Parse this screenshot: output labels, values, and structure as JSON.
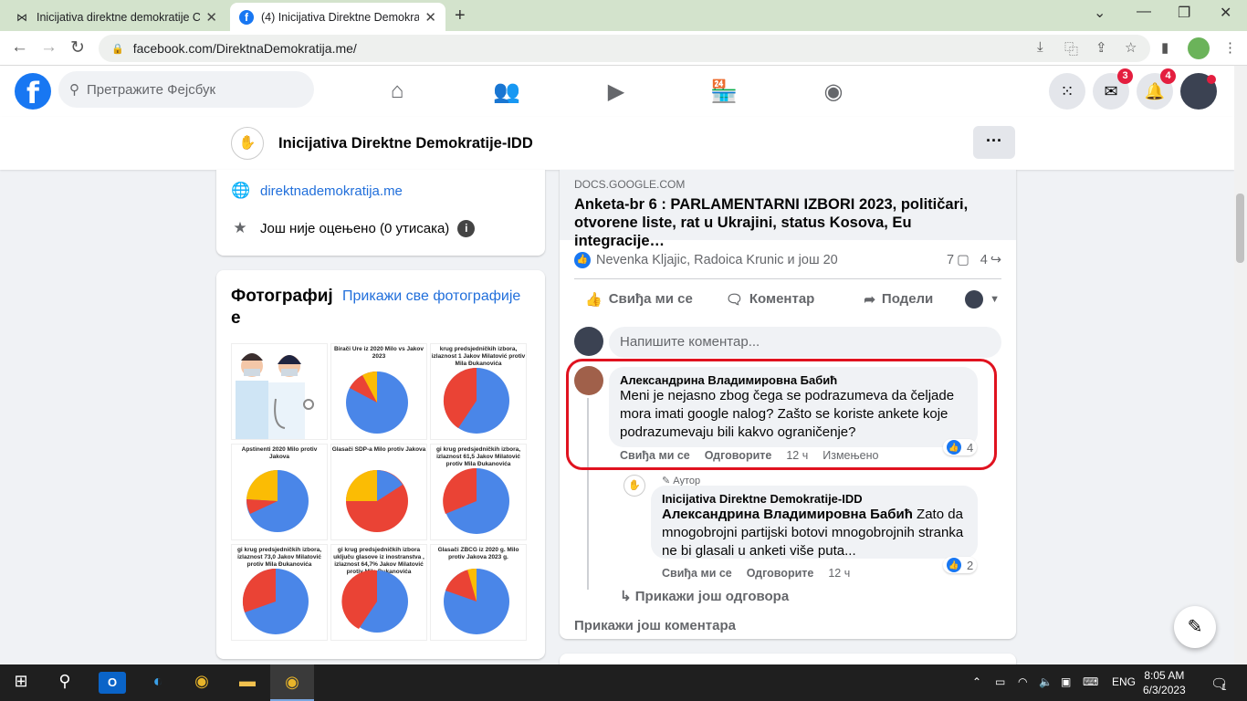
{
  "browser": {
    "tabs": [
      {
        "title": "Inicijativa direktne demokratije C",
        "active": false
      },
      {
        "title": "(4) Inicijativa Direktne Demokratij",
        "active": true
      }
    ],
    "new_tab": "+",
    "url": "facebook.com/DirektnaDemokratija.me/",
    "controls": {
      "minimize": "⌄",
      "restore": "—",
      "maximize": "❐",
      "close": "✕"
    }
  },
  "fb": {
    "logo": "f",
    "search_placeholder": "Претражите Фејсбук",
    "messenger_badge": "3",
    "notif_badge": "4"
  },
  "page": {
    "name": "Inicijativa Direktne Demokratije-IDD",
    "more": "···",
    "website": "direktnademokratija.me",
    "rating": "Још није оцењено (0 утисака)",
    "photos_title": "Фотографије",
    "photos_title_a": "Фотографиј",
    "photos_title_b": "е",
    "photos_all": "Прикажи све фотографије",
    "photos": [
      {
        "caption": ""
      },
      {
        "caption": "Birači Ure iz 2020 Milo vs Jakov 2023"
      },
      {
        "caption": "krug predsjedničkih izbora, izlaznost 1 Jakov Milatović protiv Mila Đukanovića"
      },
      {
        "caption": "Apstinenti 2020 Milo protiv Jakova"
      },
      {
        "caption": "Glasači SDP-a Milo protiv Jakova"
      },
      {
        "caption": "gi krug predsjedničkih izbora, izlaznost 61,5 Jakov Milatović protiv Mila Đukanovića"
      },
      {
        "caption": "gi krug predsjedničkih izbora, izlaznost 73,0 Jakov Milatović protiv Mila Đukanovića"
      },
      {
        "caption": "gi krug predsjedničkih izbora uključu glasove iz inostranstva , izlaznost 64,7% Jakov Milatović protiv Mila Đukanovića"
      },
      {
        "caption": "Glasači ZBCG iz 2020 g. Milo protiv Jakova 2023 g."
      }
    ]
  },
  "post": {
    "domain": "DOCS.GOOGLE.COM",
    "link_title": "Anketa-br 6 : PARLAMENTARNI IZBORI 2023, političari, otvorene liste, rat u Ukrajini, status Kosova, Eu integracije…",
    "reactors": "Nevenka Kljajic, Radoica Krunic и још 20",
    "comments_count": "7",
    "shares_count": "4",
    "like_label": "Свиђа ми се",
    "comment_label": "Коментар",
    "share_label": "Подели",
    "comment_placeholder": "Напишите коментар...",
    "comments": [
      {
        "author": "Александрина Владимировна Бабић",
        "text": "Meni je nejasno zbog čega se podrazumeva da čeljade mora imati google nalog? Zašto se koriste ankete koje podrazumevaju bili kakvo ograničenje?",
        "like": "Свиђа ми се",
        "reply": "Одговорите",
        "time": "12 ч",
        "edited": "Измењено",
        "reactions": "4"
      }
    ],
    "reply": {
      "badge": "Аутор",
      "author": "Inicijativa Direktne Demokratije-IDD",
      "mention": "Александрина Владимировна Бабић",
      "text": " Zato da mnogobrojni partijski botovi mnogobrojnih stranka ne bi glasali u anketi više puta...",
      "like": "Свиђа ми се",
      "reply": "Одговорите",
      "time": "12 ч",
      "reactions": "2"
    },
    "more_replies": "Прикажи још одговора",
    "more_comments": "Прикажи још коментара"
  },
  "taskbar": {
    "lang": "ENG",
    "time": "8:05 AM",
    "date": "6/3/2023",
    "notifications": "1"
  }
}
